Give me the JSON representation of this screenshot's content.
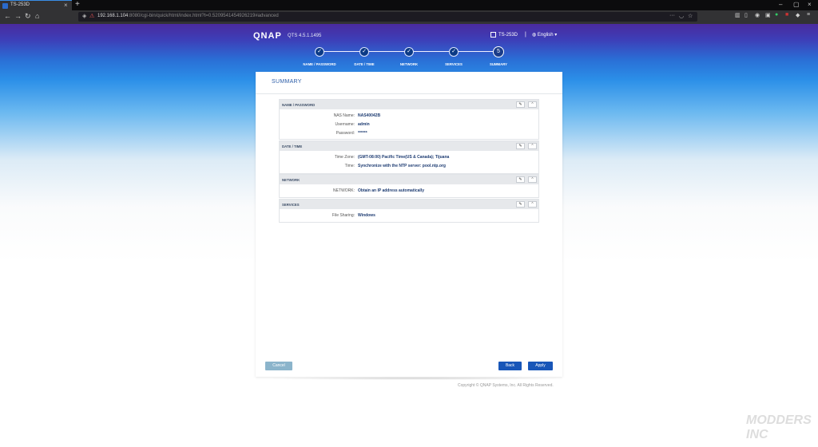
{
  "browser": {
    "tab_title": "TS-253D",
    "tab_close": "×",
    "new_tab": "+",
    "url_host": "192.168.1.104",
    "url_rest": ":8080/cgi-bin/quick/html/index.html?t=0.5209541454926219#advanced",
    "window_min": "–",
    "window_max": "▢",
    "window_close": "×"
  },
  "header": {
    "logo": "QNAP",
    "version": "QTS 4.5.1.1495",
    "model": "TS-253D",
    "separator": "|",
    "language": "English"
  },
  "steps": [
    {
      "label": "NAME / PASSWORD",
      "mark": "✓"
    },
    {
      "label": "DATE / TIME",
      "mark": "✓"
    },
    {
      "label": "NETWORK",
      "mark": "✓"
    },
    {
      "label": "SERVICES",
      "mark": "✓"
    },
    {
      "label": "SUMMARY",
      "mark": "5"
    }
  ],
  "panel": {
    "title": "SUMMARY"
  },
  "sections": {
    "name_password": {
      "title": "NAME / PASSWORD",
      "rows": [
        {
          "label": "NAS Name:",
          "value": "NAS40042B"
        },
        {
          "label": "Username:",
          "value": "admin"
        },
        {
          "label": "Password:",
          "value": "******"
        }
      ]
    },
    "date_time": {
      "title": "DATE / TIME",
      "rows": [
        {
          "label": "Time Zone:",
          "value": "(GMT-08:00) Pacific Time(US & Canada); Tijuana"
        },
        {
          "label": "Time:",
          "value": "Synchronize with the NTP server: pool.ntp.org"
        }
      ]
    },
    "network": {
      "title": "NETWORK",
      "rows": [
        {
          "label": "NETWORK:",
          "value": "Obtain an IP address automatically"
        }
      ]
    },
    "services": {
      "title": "SERVICES",
      "rows": [
        {
          "label": "File Sharing:",
          "value": "Windows"
        }
      ]
    }
  },
  "buttons": {
    "cancel": "Cancel",
    "back": "Back",
    "apply": "Apply",
    "edit_icon": "✎",
    "collapse_icon": "⌃"
  },
  "footer": {
    "copyright": "Copyright © QNAP Systems, Inc. All Rights Reserved."
  },
  "watermark": "MODDERS INC"
}
